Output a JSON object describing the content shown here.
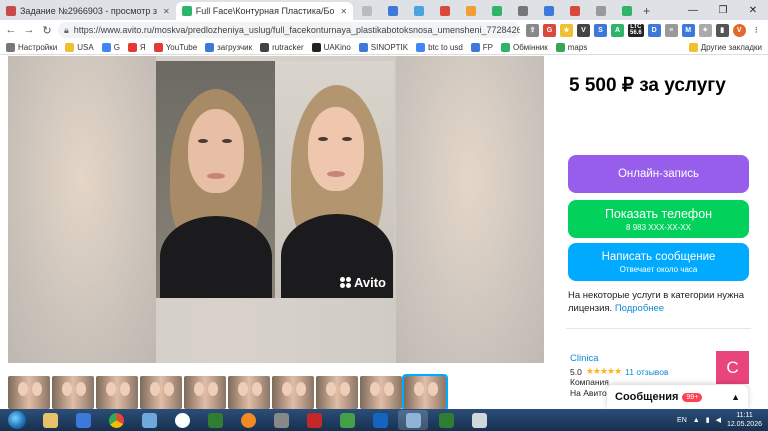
{
  "browser": {
    "tabs": [
      {
        "title": "Задание №2966903 - просмотр з",
        "icon": "sp-icon",
        "color": "#c74b4b"
      },
      {
        "title": "Full Face\\Контурная Пластика/Бо",
        "icon": "avito-icon",
        "color": "#2fb56a"
      }
    ],
    "url": "https://www.avito.ru/moskva/predlozheniya_uslug/full_facekonturnaya_plastikabotoksnosa_umensheni_7728426779?context=...",
    "bookmarks": [
      "Настройки",
      "USA",
      "G",
      "Я",
      "YouTube",
      "загрузчик",
      "rutracker",
      "UAKino",
      "SINOPTIK",
      "btc to usd",
      "FP",
      "Обмінник",
      "maps"
    ],
    "other_bookmarks": "Другие закладки",
    "ext_ltc": "LTC",
    "ext_ltc_value": "56.6"
  },
  "listing": {
    "price": "5 500 ₽ за услугу",
    "watermark": "Avito",
    "online_booking": "Онлайн-запись",
    "show_phone": "Показать телефон",
    "phone_masked": "8 983 XXX-XX-XX",
    "write_message": "Написать сообщение",
    "reply_time": "Отвечает около часа",
    "license_text": "На некоторые услуги в категории нужна лицензия.",
    "license_link": "Подробнее"
  },
  "seller": {
    "name": "Clinica",
    "rating": "5.0",
    "reviews": "11 отзывов",
    "type": "Компания",
    "since": "На Авито с",
    "avatar_letter": "C"
  },
  "messages": {
    "label": "Сообщения",
    "count": "99+"
  },
  "taskbar": {
    "lang": "EN",
    "time": "11:11",
    "date": "12.05.2026"
  }
}
